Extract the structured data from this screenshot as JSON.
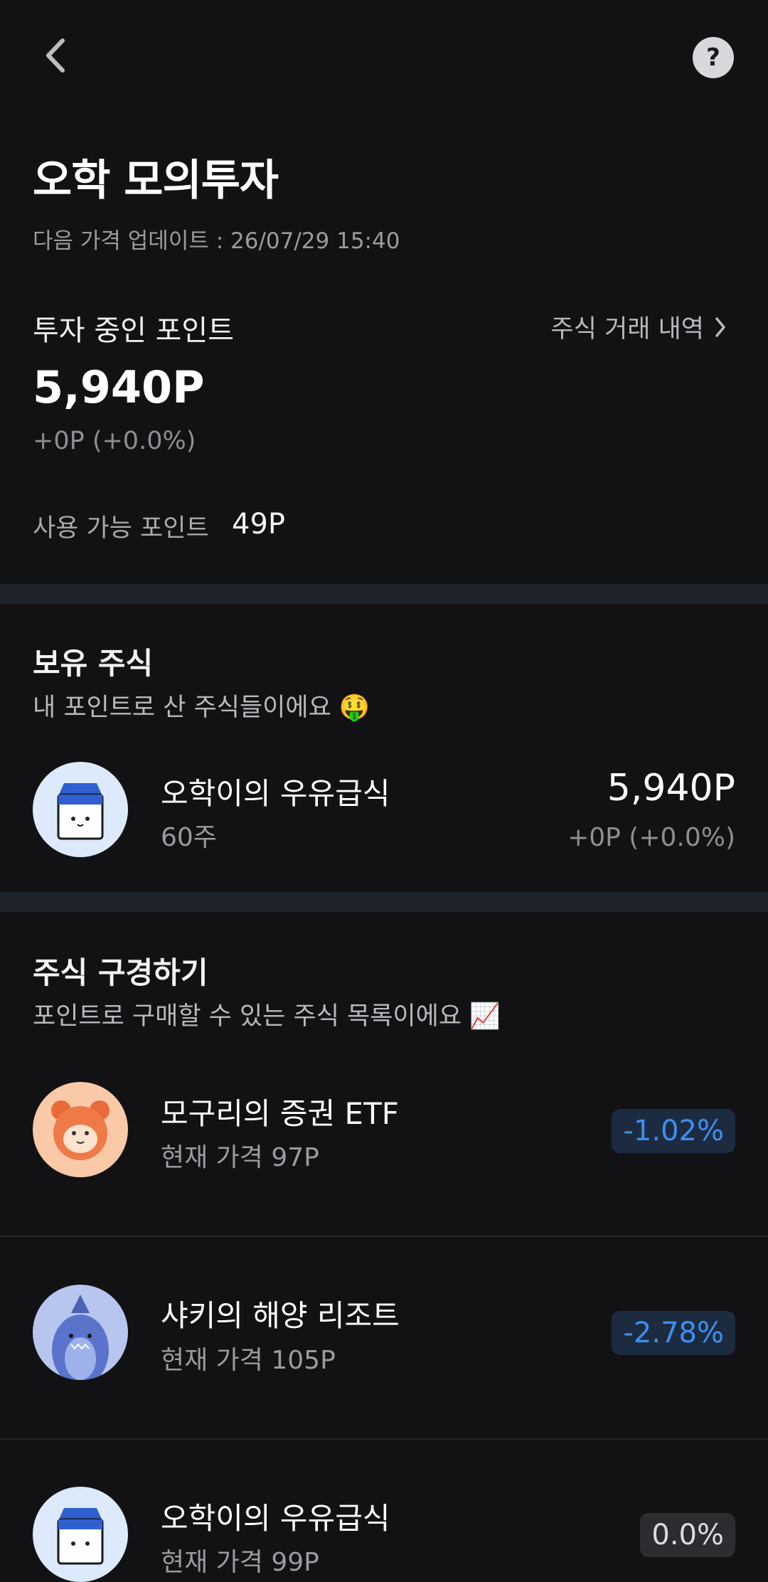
{
  "header": {
    "back_icon": "chevron-left-icon",
    "help_icon": "question-icon",
    "help_glyph": "?"
  },
  "title": "오학 모의투자",
  "update_text": "다음 가격 업데이트 : 26/07/29 15:40",
  "investing": {
    "label": "투자 중인 포인트",
    "history_link": "주식 거래 내역",
    "value": "5,940P",
    "change": "+0P (+0.0%)",
    "available_label": "사용 가능 포인트",
    "available_value": "49P"
  },
  "holdings": {
    "title": "보유 주식",
    "subtitle": "내 포인트로 산 주식들이에요 🤑",
    "items": [
      {
        "name": "오학이의 우유급식",
        "shares": "60주",
        "value": "5,940P",
        "change": "+0P (+0.0%)",
        "icon": "milk-carton-icon"
      }
    ]
  },
  "browse": {
    "title": "주식 구경하기",
    "subtitle": "포인트로 구매할 수 있는 주식 목록이에요 📈",
    "items": [
      {
        "name": "모구리의 증권 ETF",
        "price": "현재 가격 97P",
        "change": "-1.02%",
        "icon": "raccoon-icon"
      },
      {
        "name": "샤키의 해양 리조트",
        "price": "현재 가격 105P",
        "change": "-2.78%",
        "icon": "shark-icon"
      },
      {
        "name": "오학이의 우유급식",
        "price": "현재 가격 99P",
        "change": "0.0%",
        "icon": "milk-carton-icon"
      }
    ]
  },
  "colors": {
    "background": "#121214",
    "negative": "#3d8ff0",
    "divider": "#1f232a"
  }
}
